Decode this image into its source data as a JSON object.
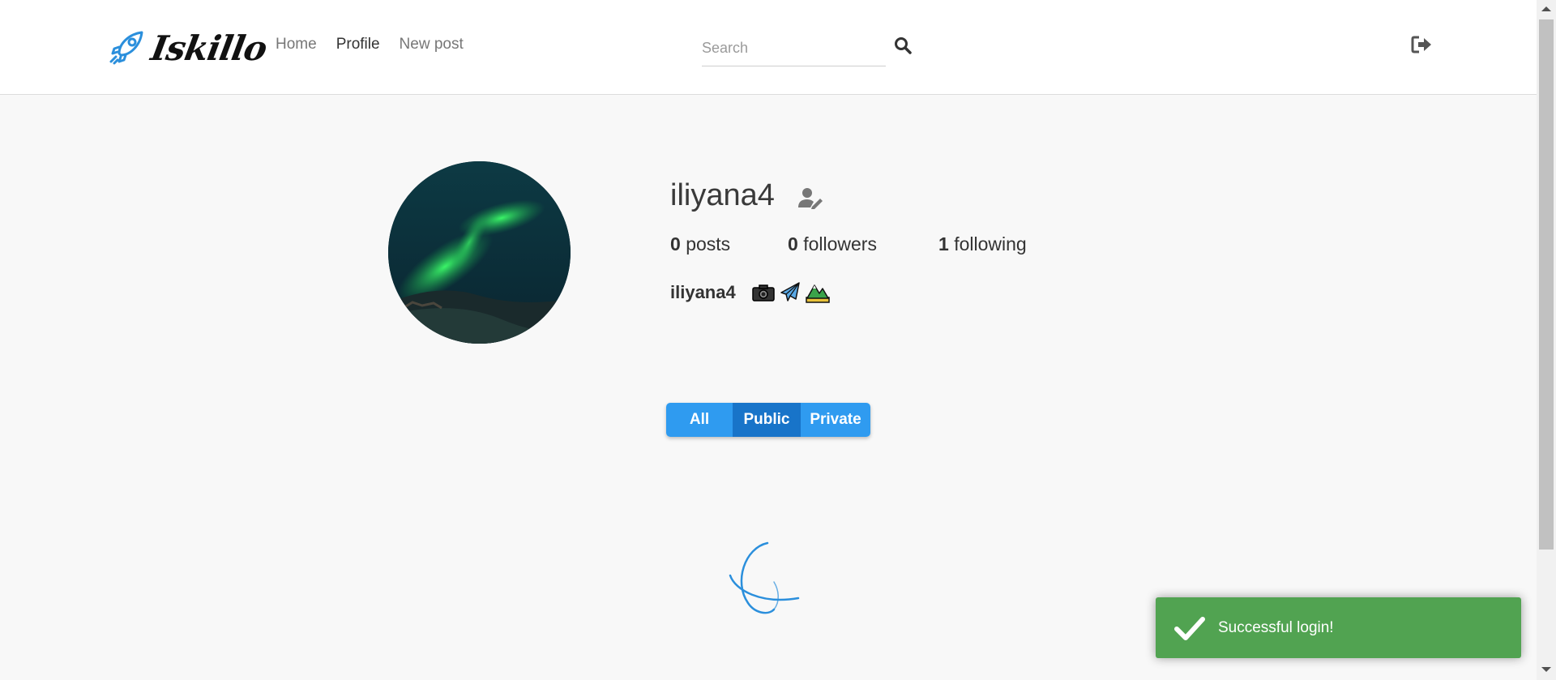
{
  "header": {
    "brand_name": "Iskillo",
    "nav": [
      {
        "label": "Home",
        "active": false
      },
      {
        "label": "Profile",
        "active": true
      },
      {
        "label": "New post",
        "active": false
      }
    ],
    "search": {
      "placeholder": "Search",
      "value": ""
    }
  },
  "profile": {
    "username": "iliyana4",
    "stats": {
      "posts": {
        "count": "0",
        "label": "posts"
      },
      "followers": {
        "count": "0",
        "label": "followers"
      },
      "following": {
        "count": "1",
        "label": "following"
      }
    },
    "bio_name": "iliyana4",
    "bio_emojis": [
      "camera-icon",
      "airplane-icon",
      "mountain-icon"
    ]
  },
  "filters": {
    "all": "All",
    "public": "Public",
    "private": "Private",
    "selected": "public"
  },
  "toast": {
    "message": "Successful login!",
    "type": "success"
  },
  "colors": {
    "brand_blue": "#2f9bf0",
    "selected_blue": "#1874c9",
    "toast_green": "#51a351",
    "background": "#f8f8f8"
  }
}
